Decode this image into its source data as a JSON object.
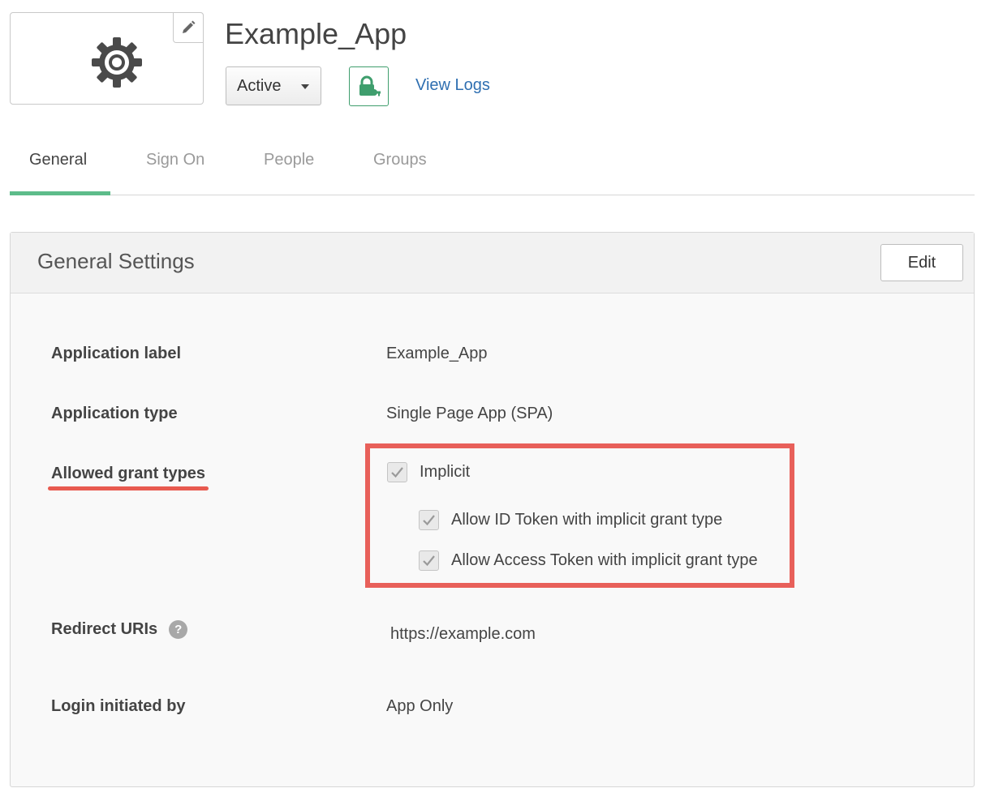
{
  "app": {
    "title": "Example_App",
    "status": "Active",
    "view_logs_label": "View Logs",
    "accent_color": "#5dbc8a",
    "link_color": "#2f6fb1",
    "highlight_color": "#e8605a"
  },
  "tabs": [
    {
      "label": "General",
      "active": true
    },
    {
      "label": "Sign On",
      "active": false
    },
    {
      "label": "People",
      "active": false
    },
    {
      "label": "Groups",
      "active": false
    }
  ],
  "panel": {
    "title": "General Settings",
    "edit_label": "Edit"
  },
  "fields": {
    "application_label": {
      "label": "Application label",
      "value": "Example_App"
    },
    "application_type": {
      "label": "Application type",
      "value": "Single Page App (SPA)"
    },
    "grant_types": {
      "label": "Allowed grant types",
      "options": [
        {
          "label": "Implicit",
          "checked": true
        },
        {
          "label": "Allow ID Token with implicit grant type",
          "checked": true
        },
        {
          "label": "Allow Access Token with implicit grant type",
          "checked": true
        }
      ]
    },
    "redirect_uris": {
      "label": "Redirect URIs",
      "value": "https://example.com",
      "help_glyph": "?"
    },
    "login_initiated_by": {
      "label": "Login initiated by",
      "value": "App Only"
    }
  },
  "icons": [
    "gear-icon",
    "pencil-icon",
    "caret-down-icon",
    "lock-key-icon",
    "checkmark-icon",
    "help-icon"
  ]
}
